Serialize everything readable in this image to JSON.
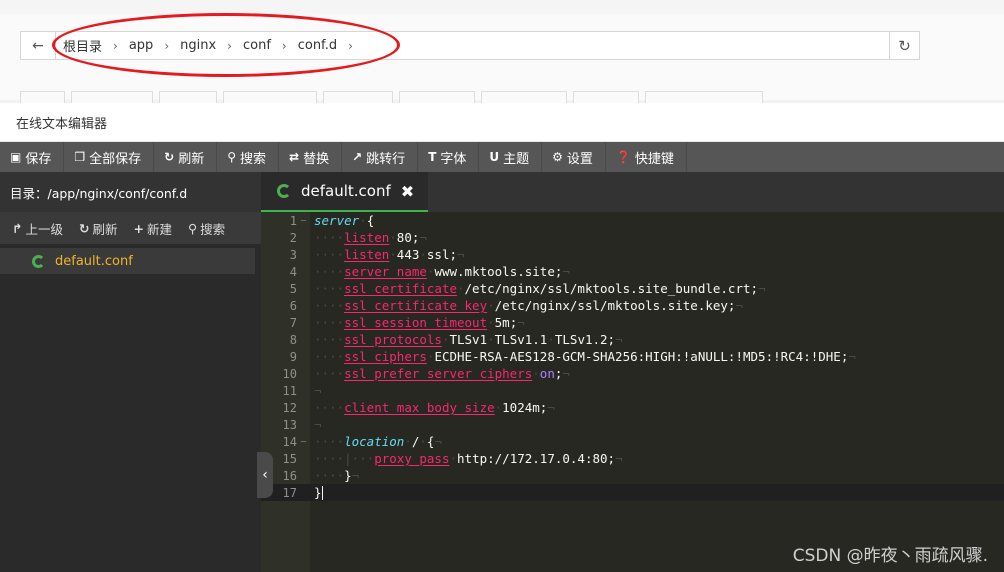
{
  "pathbar": {
    "crumbs": [
      "根目录",
      "app",
      "nginx",
      "conf",
      "conf.d"
    ]
  },
  "editor_window": {
    "title": "在线文本编辑器"
  },
  "toolbar": {
    "save": "保存",
    "save_all": "全部保存",
    "refresh": "刷新",
    "search": "搜索",
    "replace": "替换",
    "goto_line": "跳转行",
    "font": "字体",
    "theme": "主题",
    "settings": "设置",
    "shortcuts": "快捷键"
  },
  "left_panel": {
    "dir_label": "目录：/app/nginx/conf/conf.d",
    "tools": {
      "up": "上一级",
      "refresh": "刷新",
      "new": "新建",
      "search": "搜索"
    },
    "files": [
      "default.conf"
    ]
  },
  "tab": {
    "filename": "default.conf"
  },
  "code_lines": [
    "server {",
    "    listen 80;",
    "    listen 443 ssl;",
    "    server_name www.mktools.site;",
    "    ssl_certificate /etc/nginx/ssl/mktools.site_bundle.crt;",
    "    ssl_certificate_key /etc/nginx/ssl/mktools.site.key;",
    "    ssl_session_timeout 5m;",
    "    ssl_protocols TLSv1 TLSv1.1 TLSv1.2;",
    "    ssl_ciphers ECDHE-RSA-AES128-GCM-SHA256:HIGH:!aNULL:!MD5:!RC4:!DHE;",
    "    ssl_prefer_server_ciphers on;",
    "",
    "    client_max_body_size 1024m;",
    "",
    "    location / {",
    "        proxy_pass http://172.17.0.4:80;",
    "    }",
    "}"
  ],
  "watermark": "CSDN @昨夜丶雨疏风骤.",
  "colors": {
    "annotation_oval": "#e5191e",
    "toolbar_bg": "#565656",
    "editor_bg": "#272822",
    "tab_accent": "#3fb34f",
    "file_highlight": "#f0b429"
  }
}
